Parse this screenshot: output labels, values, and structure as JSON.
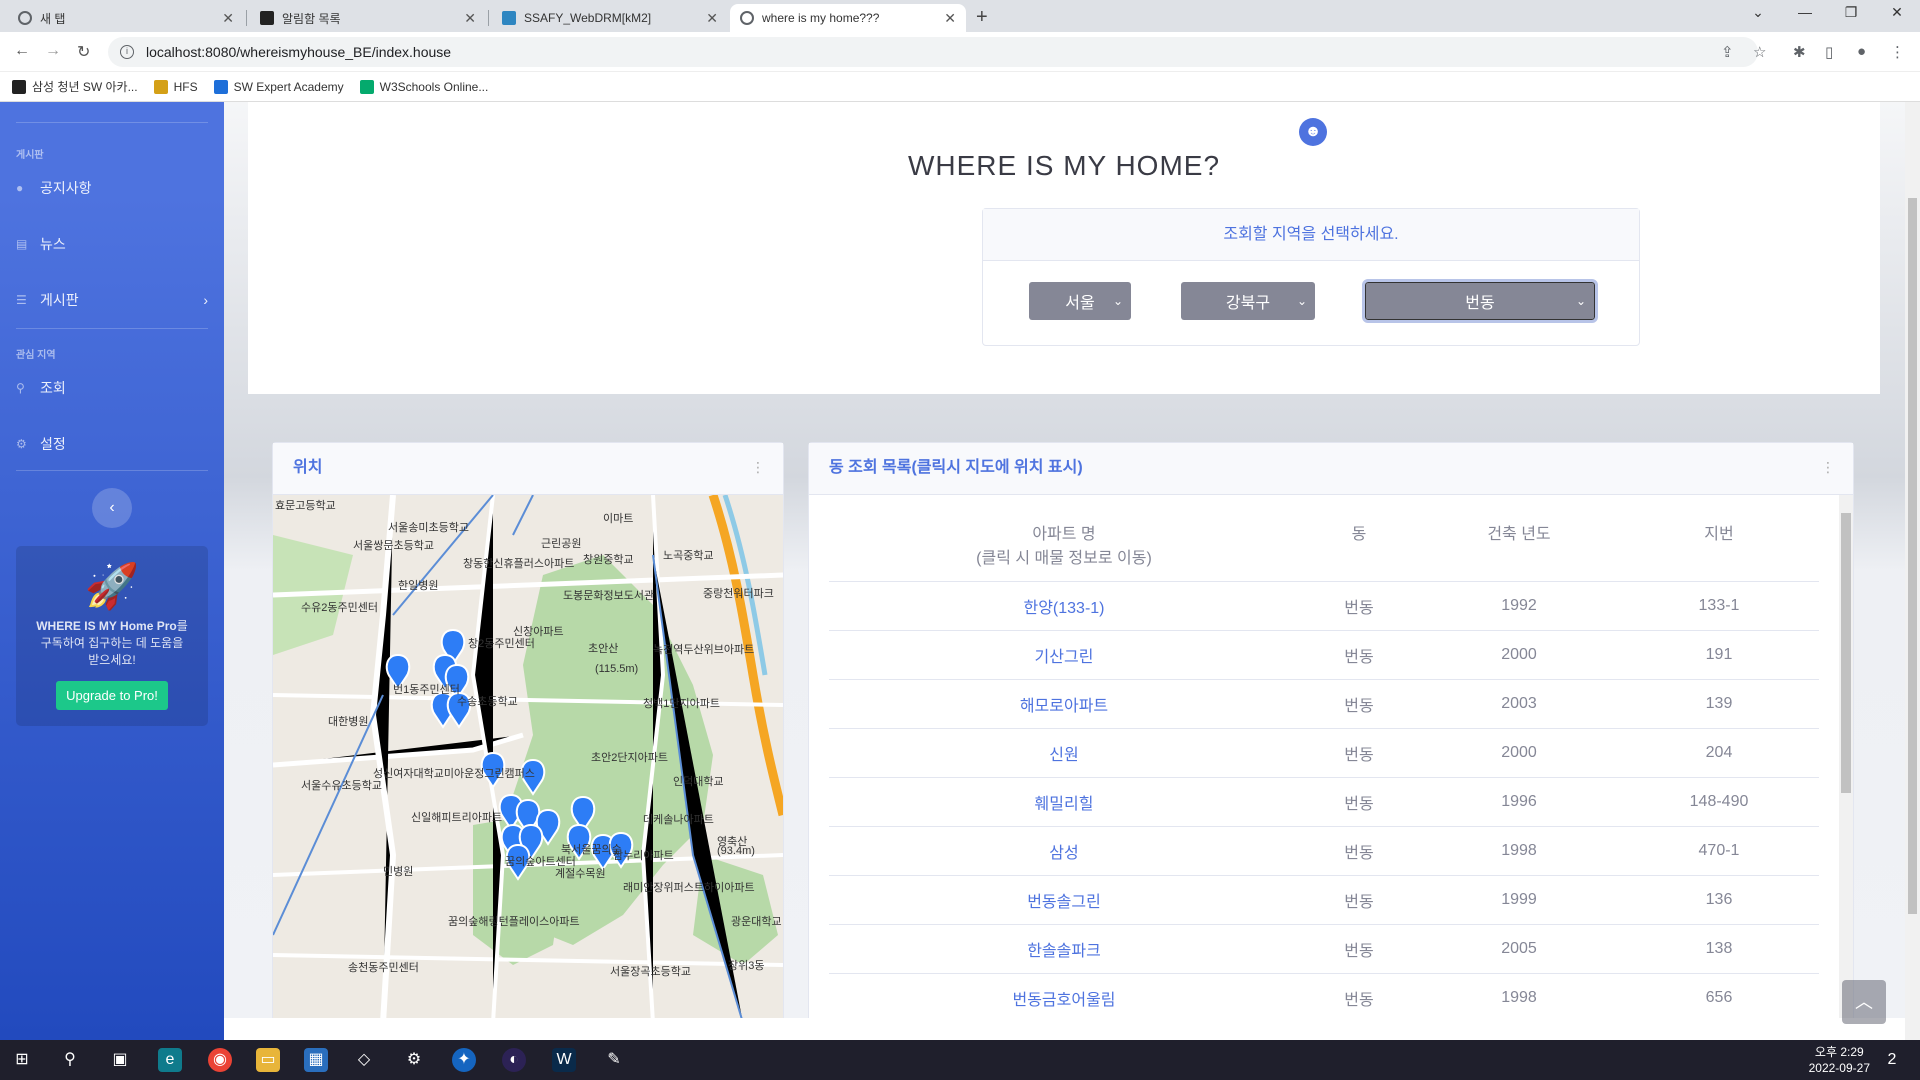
{
  "browser": {
    "tabs": [
      {
        "label": "새 탭",
        "active": false,
        "favicon_color": "#5f6368"
      },
      {
        "label": "알림함 목록",
        "active": false,
        "favicon_color": "#222222"
      },
      {
        "label": "SSAFY_WebDRM[kM2]",
        "active": false,
        "favicon_color": "#2e86c1"
      },
      {
        "label": "where is my home???",
        "active": true,
        "favicon_color": "#5f6368"
      }
    ],
    "url": "localhost:8080/whereismyhouse_BE/index.house",
    "bookmarks": [
      {
        "label": "삼성 청년 SW 아카...",
        "color": "#222222"
      },
      {
        "label": "HFS",
        "color": "#d4a017"
      },
      {
        "label": "SW Expert Academy",
        "color": "#1e6fd9"
      },
      {
        "label": "W3Schools Online...",
        "color": "#04aa6d"
      }
    ]
  },
  "sidebar": {
    "heading_board": "게시판",
    "items_board": [
      {
        "label": "공지사항",
        "icon": "map-marker-icon"
      },
      {
        "label": "뉴스",
        "icon": "newspaper-icon"
      },
      {
        "label": "게시판",
        "icon": "list-icon"
      }
    ],
    "heading_interest": "관심 지역",
    "items_interest": [
      {
        "label": "조회",
        "icon": "search-icon"
      },
      {
        "label": "설정",
        "icon": "gear-icon"
      }
    ],
    "promo_text_bold": "WHERE IS MY Home Pro",
    "promo_text": "를 구독하여 집구하는 데 도움을 받으세요!",
    "promo_button": "Upgrade to Pro!"
  },
  "header": {
    "title": "WHERE IS MY HOME?",
    "select_prompt": "조회할 지역을 선택하세요.",
    "sido": "서울",
    "gugun": "강북구",
    "dong": "번동"
  },
  "map_card": {
    "title": "위치",
    "labels": [
      "효문고등학교",
      "서울송미초등학교",
      "서울쌍문초등학교",
      "한일병원",
      "수유2동주민센터",
      "창동한신휴플러스아파트",
      "도봉문화정보도서관",
      "이마트",
      "창원중학교",
      "근린공원",
      "노곡중학교",
      "신창아파트",
      "창2동주민센터",
      "번1동주민센터",
      "대한병원",
      "수송초등학교",
      "초안산",
      "(115.5m)",
      "청백1단지아파트",
      "녹천역두산위브아파트",
      "중랑천워터파크",
      "초안2단지아파트",
      "인덕대학교",
      "성신여자대학교미아운정그린캠퍼스",
      "서울수유초등학교",
      "신일해피트리아파트",
      "북서울꿈의숲",
      "계절수목원",
      "데케솔나아파트",
      "참누리아파트",
      "영축산",
      "(93.4m)",
      "민병원",
      "꿈의숲아트센터",
      "래미안장위퍼스트하이아파트",
      "꿈의숲해링턴플레이스아파트",
      "송천동주민센터",
      "광운대학교",
      "장위3동",
      "서울장곡초등학교"
    ]
  },
  "list_card": {
    "title": "동 조회 목록(클릭시 지도에 위치 표시)",
    "headers": [
      "아파트 명",
      "(클릭 시 매물 정보로 이동)",
      "동",
      "건축 년도",
      "지번"
    ],
    "rows": [
      [
        "한양(133-1)",
        "번동",
        "1992",
        "133-1"
      ],
      [
        "기산그린",
        "번동",
        "2000",
        "191"
      ],
      [
        "해모로아파트",
        "번동",
        "2003",
        "139"
      ],
      [
        "신원",
        "번동",
        "2000",
        "204"
      ],
      [
        "훼밀리힐",
        "번동",
        "1996",
        "148-490"
      ],
      [
        "삼성",
        "번동",
        "1998",
        "470-1"
      ],
      [
        "번동솔그린",
        "번동",
        "1999",
        "136"
      ],
      [
        "한솔솔파크",
        "번동",
        "2005",
        "138"
      ],
      [
        "번동금호어울림",
        "번동",
        "1998",
        "656"
      ]
    ]
  },
  "taskbar": {
    "time": "오후 2:29",
    "date": "2022-09-27",
    "notifications": "2"
  },
  "colors": {
    "primary": "#4e73df",
    "success": "#1cc88a",
    "secondary": "#858796"
  }
}
